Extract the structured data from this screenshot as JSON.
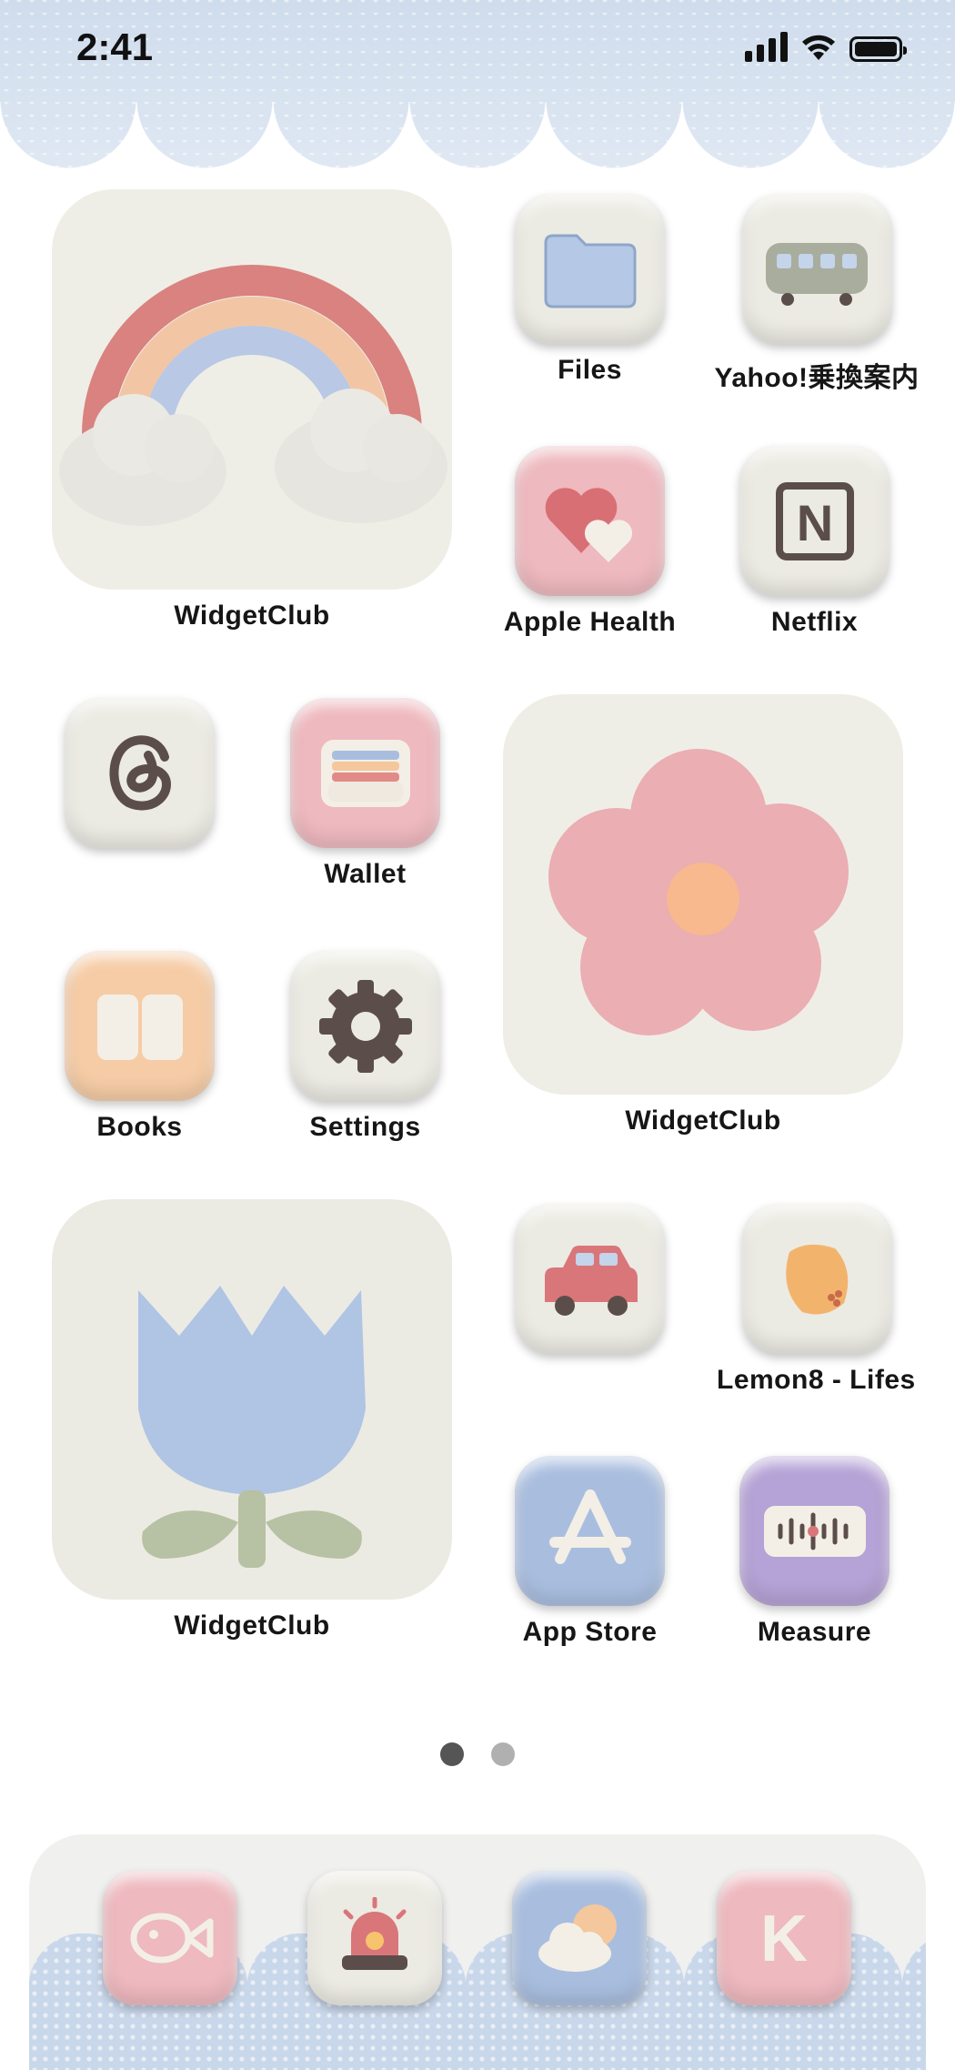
{
  "status_bar": {
    "time": "2:41"
  },
  "widgets": [
    {
      "label": "WidgetClub",
      "icon": "rainbow-icon"
    },
    {
      "label": "WidgetClub",
      "icon": "flower-icon"
    },
    {
      "label": "WidgetClub",
      "icon": "tulip-icon"
    }
  ],
  "apps": {
    "files": {
      "label": "Files",
      "icon": "folder-icon"
    },
    "yahoo": {
      "label": "Yahoo!乗換案内",
      "icon": "train-icon"
    },
    "apple_health": {
      "label": "Apple Health",
      "icon": "heart-icon"
    },
    "netflix": {
      "label": "Netflix",
      "icon": "n-letter-icon"
    },
    "threads": {
      "label": "",
      "icon": "threads-icon"
    },
    "wallet": {
      "label": "Wallet",
      "icon": "wallet-icon"
    },
    "books": {
      "label": "Books",
      "icon": "book-icon"
    },
    "settings": {
      "label": "Settings",
      "icon": "gear-icon"
    },
    "car": {
      "label": "",
      "icon": "car-icon"
    },
    "lemon8": {
      "label": "Lemon8 - Lifes",
      "icon": "lemon-icon"
    },
    "app_store": {
      "label": "App Store",
      "icon": "app-store-icon"
    },
    "measure": {
      "label": "Measure",
      "icon": "ruler-icon"
    }
  },
  "page_indicator": {
    "pages": 2,
    "current": 1
  },
  "dock": [
    {
      "icon": "fish-icon"
    },
    {
      "icon": "siren-icon"
    },
    {
      "icon": "weather-icon"
    },
    {
      "icon": "k-letter-icon"
    }
  ],
  "colors": {
    "pink": "#eeb9bf",
    "blue": "#a9bedf",
    "cream": "#ecebe3",
    "peach": "#f6cca6",
    "purple": "#b5a2d6"
  }
}
